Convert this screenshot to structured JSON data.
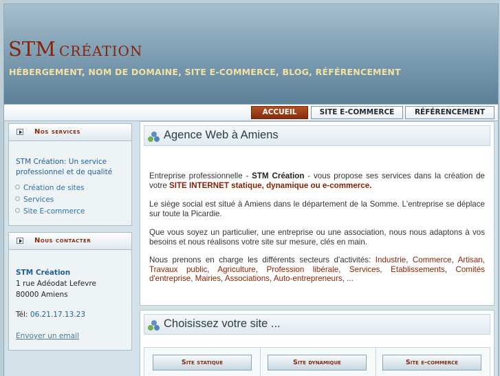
{
  "header": {
    "title_big": "STM",
    "title_small": "CRÉATION",
    "tagline": "HÉBERGEMENT, NOM DE DOMAINE, SITE E-COMMERCE, BLOG, RÉFÉRENCEMENT"
  },
  "nav": {
    "items": [
      {
        "label": "ACCUEIL",
        "active": true
      },
      {
        "label": "SITE E-COMMERCE",
        "active": false
      },
      {
        "label": "RÉFÉRENCEMENT",
        "active": false
      }
    ]
  },
  "sidebar": {
    "services": {
      "title": "Nos services",
      "intro": "STM Création: Un service professionnel et de qualité",
      "links": [
        "Création de sites",
        "Services",
        "Site E-commerce"
      ]
    },
    "contact": {
      "title": "Nous contacter",
      "company": "STM Création",
      "address1": "1 rue Adéodat Lefevre",
      "address2": "80000 Amiens",
      "phone_label": "Tél:",
      "phone": "06.21.17.13.23",
      "email_link": "Envoyer un email"
    }
  },
  "main": {
    "title": "Agence Web à Amiens",
    "p1": {
      "a": "Entreprise professionnelle - ",
      "b": "STM Création",
      "c": " - vous propose ses services dans la création de votre ",
      "d": "SITE INTERNET statique, dynamique ou e-commerce."
    },
    "p2": "Le siège social est situé à Amiens dans le département de la Somme. L'entreprise se déplace sur toute la Picardie.",
    "p3": "Que vous soyez un particulier, une entreprise ou une association, nous nous adaptons à vos besoins et nous réalisons votre site sur mesure, clés en main.",
    "p4": {
      "intro": "Nous prenons en charge les différents secteurs d'activités: ",
      "sectors": [
        "Industrie",
        "Commerce",
        "Artisan",
        "Travaux public",
        "Agriculture",
        "Profession libérale",
        "Services",
        "Etablissements",
        "Comités d'entreprise",
        "Mairies",
        "Associations",
        "Auto-entrepreneurs"
      ],
      "ellipsis": "..."
    }
  },
  "choose": {
    "title": "Choisissez votre site ...",
    "buttons": [
      "Site statique",
      "Site dynamique",
      "Site e-commerce"
    ]
  },
  "colors": {
    "accent": "#8a2208",
    "link": "#1f5fa0",
    "tagline": "#f2e2a2"
  }
}
